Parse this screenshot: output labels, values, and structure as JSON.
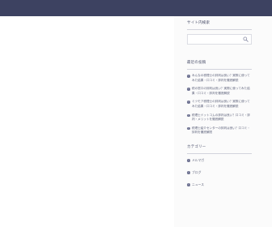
{
  "sidebar": {
    "search": {
      "title": "サイト内検索",
      "placeholder": ""
    },
    "recent_posts": {
      "title": "最近の投稿",
      "items": [
        {
          "label": "みんなの税理士の評判は良い？実際に使ってみた結果・口コミ・評判を徹底解説"
        },
        {
          "label": "税の窓口の評判は良い？実際に使ってみた結果・口コミ・評判を徹底解説"
        },
        {
          "label": "ミツモア税理士の評判は良い？実際に使ってみた結果・口コミ・評判を徹底解説"
        },
        {
          "label": "税理士ドットコムの評判は良い？口コミ・評判・メリットを徹底解説"
        },
        {
          "label": "税理士紹介センターの評判は良い？口コミ・評判を徹底解説"
        }
      ]
    },
    "categories": {
      "title": "カテゴリー",
      "items": [
        {
          "label": "メルマガ"
        },
        {
          "label": "ブログ"
        },
        {
          "label": "ニュース"
        }
      ]
    }
  }
}
